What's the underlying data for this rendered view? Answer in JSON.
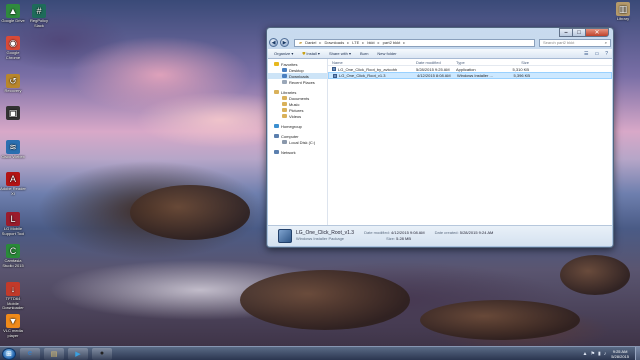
{
  "desktop": {
    "icons_left": [
      {
        "label": "Google Drive",
        "icon": "drive-icon",
        "color": "#2f8a3e"
      },
      {
        "label": "Google Chrome",
        "icon": "chrome-icon",
        "color": "#d94a38"
      },
      {
        "label": "Recovery",
        "icon": "recovery-icon",
        "color": "#b8862c"
      },
      {
        "label": "",
        "icon": "app-icon",
        "color": "#333333"
      },
      {
        "label": "Cisco Webex",
        "icon": "webex-icon",
        "color": "#2b6fb0"
      },
      {
        "label": "Adobe Reader XI",
        "icon": "adobe-reader-icon",
        "color": "#b31414"
      },
      {
        "label": "LG Mobile Support Tool",
        "icon": "lg-support-icon",
        "color": "#9a1c2c"
      },
      {
        "label": "Camtasia Studio 2015",
        "icon": "camtasia-icon",
        "color": "#2a8a3a"
      },
      {
        "label": "TFTD64 Mobile Downloader",
        "icon": "downloader-icon",
        "color": "#c23a2a"
      },
      {
        "label": "VLC media player",
        "icon": "vlc-icon",
        "color": "#f08a1a"
      }
    ],
    "icon_top_second": {
      "label": "RegPolicy Slack",
      "icon": "slack-icon",
      "color": "#1e6b5a"
    },
    "icon_right": {
      "label": "Library",
      "icon": "library-icon",
      "color": "#b59a6a"
    }
  },
  "explorer": {
    "address": [
      "Daniel",
      "Downloads",
      "LTE",
      "bkkt",
      "part2 bkkt"
    ],
    "search_placeholder": "Search part2 bkkt",
    "toolbar": [
      "Organize ▾",
      "Install ▾",
      "Share with ▾",
      "Burn",
      "New folder"
    ],
    "nav": [
      {
        "label": "Favorites",
        "type": "head",
        "icon": "star-icon",
        "color": "#e7b81e"
      },
      {
        "label": "Desktop",
        "type": "sub",
        "icon": "desktop-icon",
        "color": "#4a7fbf"
      },
      {
        "label": "Downloads",
        "type": "sub",
        "icon": "downloads-icon",
        "color": "#4a7fbf",
        "selected": true
      },
      {
        "label": "Recent Places",
        "type": "sub",
        "icon": "recent-places-icon",
        "color": "#9aa7b8"
      },
      {
        "label": "Libraries",
        "type": "head",
        "icon": "libraries-icon",
        "color": "#d9b15a",
        "gap": true
      },
      {
        "label": "Documents",
        "type": "sub",
        "icon": "documents-icon",
        "color": "#d9b15a"
      },
      {
        "label": "Music",
        "type": "sub",
        "icon": "music-icon",
        "color": "#d9b15a"
      },
      {
        "label": "Pictures",
        "type": "sub",
        "icon": "pictures-icon",
        "color": "#d9b15a"
      },
      {
        "label": "Videos",
        "type": "sub",
        "icon": "videos-icon",
        "color": "#d9b15a"
      },
      {
        "label": "Homegroup",
        "type": "head",
        "icon": "homegroup-icon",
        "color": "#3b8fd0",
        "gap": true
      },
      {
        "label": "Computer",
        "type": "head",
        "icon": "computer-icon",
        "color": "#5b7fae",
        "gap": true
      },
      {
        "label": "Local Disk (C:)",
        "type": "sub",
        "icon": "disk-icon",
        "color": "#8a98ab"
      },
      {
        "label": "Network",
        "type": "head",
        "icon": "network-icon",
        "color": "#5b7fae",
        "gap": true
      }
    ],
    "columns": [
      "Name",
      "Date modified",
      "Type",
      "Size"
    ],
    "files": [
      {
        "name": "LG_One_Click_Root_by_avicohh",
        "date": "5/28/2015 9:25 AM",
        "type": "Application",
        "size": "5,310 KB",
        "selected": false
      },
      {
        "name": "LG_One_Click_Root_v1.3",
        "date": "4/12/2015 8:08 AM",
        "type": "Windows Installer ...",
        "size": "5,396 KB",
        "selected": true
      }
    ],
    "details": {
      "name": "LG_One_Click_Root_v1.3",
      "kind": "Windows Installer Package",
      "date_modified_label": "Date modified:",
      "date_modified": "4/12/2015 9:08 AM",
      "size_label": "Size:",
      "size": "5.28 MB",
      "date_created_label": "Date created:",
      "date_created": "5/28/2015 9:24 AM"
    }
  },
  "taskbar": {
    "tasks": [
      {
        "icon": "internet-explorer-icon",
        "glyph": "e",
        "color": "#2f7fd0"
      },
      {
        "icon": "explorer-folder-icon",
        "glyph": "▤",
        "color": "#e0c06a"
      },
      {
        "icon": "media-player-icon",
        "glyph": "▶",
        "color": "#3aa0e0"
      },
      {
        "icon": "camera-app-icon",
        "glyph": "●",
        "color": "#222222"
      }
    ],
    "tray_icons": [
      "▲",
      "⚑",
      "▮",
      "♪"
    ],
    "time": "9:25 AM",
    "date": "5/28/2015"
  }
}
